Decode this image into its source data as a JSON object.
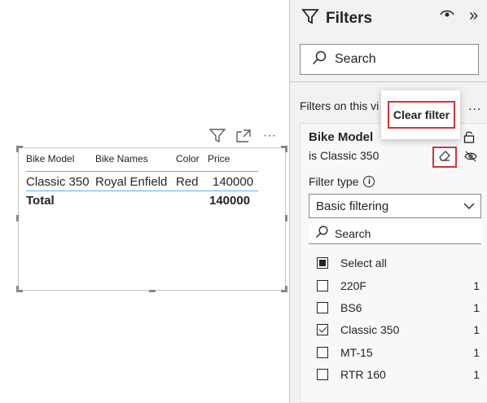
{
  "visual": {
    "columns": [
      "Bike Model",
      "Bike Names",
      "Color",
      "Price"
    ],
    "row": {
      "bike_model": "Classic 350",
      "bike_name": "Royal Enfield",
      "color": "Red",
      "price": "140000"
    },
    "total": {
      "label": "Total",
      "price": "140000"
    },
    "toolbar_more": "···",
    "rule_color": "#5ab4e5"
  },
  "filters_pane": {
    "title": "Filters",
    "search_placeholder": "Search",
    "section_label": "Filters on this vi",
    "section_more": "...",
    "card": {
      "title": "Bike Model",
      "subtitle": "is Classic 350",
      "small_more": "...",
      "filter_type_label": "Filter type",
      "info_glyph": "i",
      "dropdown_value": "Basic filtering",
      "search_placeholder": "Search",
      "options": [
        {
          "label": "Select all",
          "count": "",
          "state": "partial"
        },
        {
          "label": "220F",
          "count": "1",
          "state": "unchecked"
        },
        {
          "label": "BS6",
          "count": "1",
          "state": "unchecked"
        },
        {
          "label": "Classic 350",
          "count": "1",
          "state": "checked"
        },
        {
          "label": "MT-15",
          "count": "1",
          "state": "unchecked"
        },
        {
          "label": "RTR 160",
          "count": "1",
          "state": "unchecked"
        }
      ]
    },
    "collapse_glyph": "»"
  },
  "tooltip": {
    "label": "Clear filter"
  },
  "colors": {
    "highlight": "#d13438",
    "pane_bg": "#f3f2f1"
  },
  "icons": [
    "filter-icon",
    "eye-icon",
    "collapse-icon",
    "search-icon",
    "lock-icon",
    "eraser-icon",
    "hide-icon",
    "info-icon",
    "chevron-down-icon",
    "focus-mode-icon",
    "more-options-icon"
  ]
}
